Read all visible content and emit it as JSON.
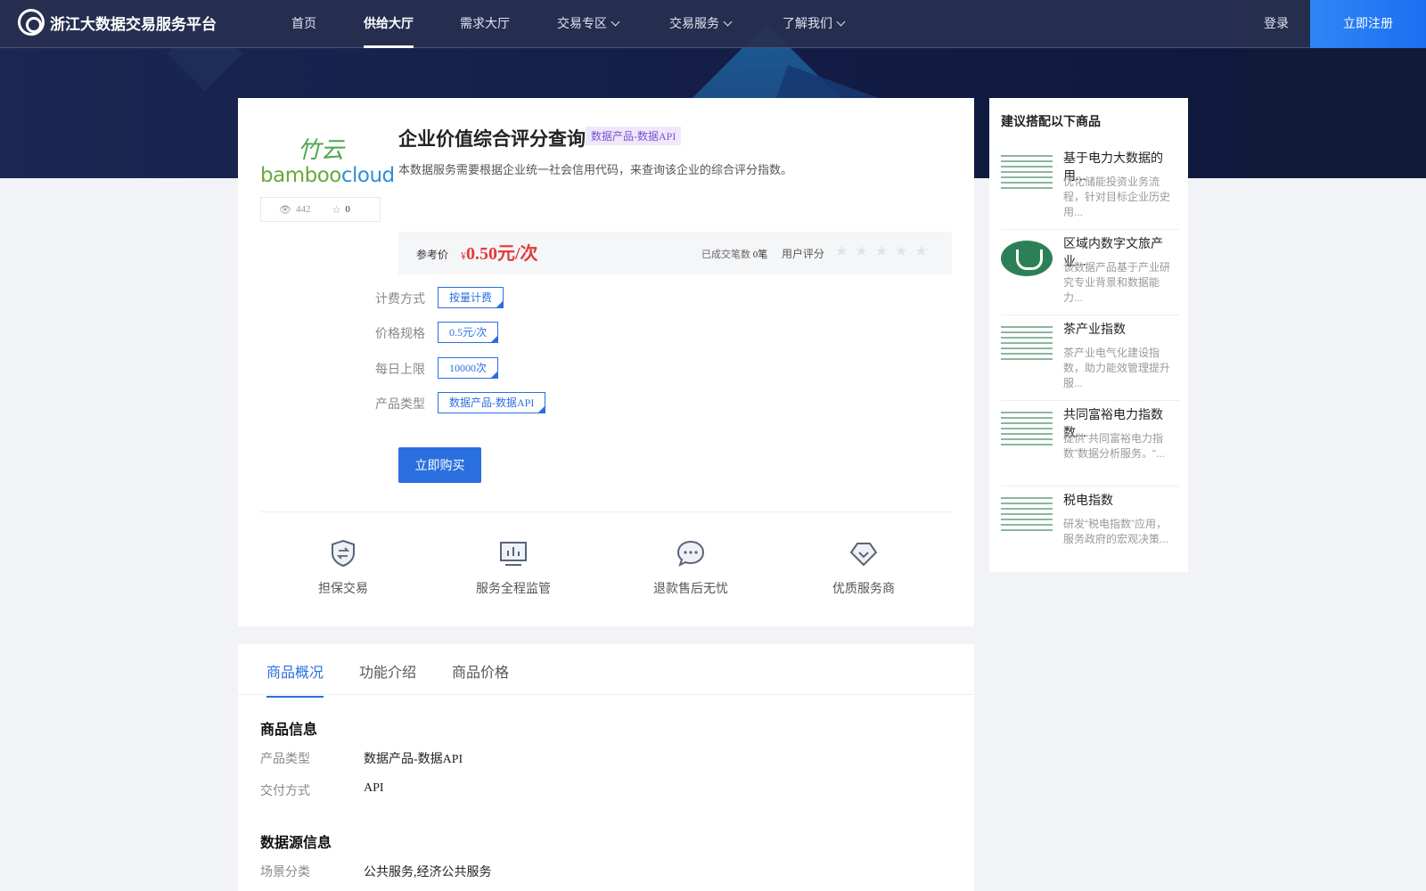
{
  "nav": {
    "brand": "浙江大数据交易服务平台",
    "items": [
      {
        "label": "首页"
      },
      {
        "label": "供给大厅"
      },
      {
        "label": "需求大厅"
      },
      {
        "label": "交易专区"
      },
      {
        "label": "交易服务"
      },
      {
        "label": "了解我们"
      }
    ],
    "login": "登录",
    "register": "立即注册"
  },
  "product": {
    "logo_cn": "竹云",
    "logo_en_a": "bamboo",
    "logo_en_b": "cloud",
    "views": "442",
    "favorites": "0",
    "title": "企业价值综合评分查询",
    "tag": "数据产品-数据API",
    "description": "本数据服务需要根据企业统一社会信用代码，来查询该企业的综合评分指数。",
    "price_label": "参考价",
    "currency": "¥",
    "price": "0.50元/次",
    "deals_label": "已成交笔数",
    "deals_value": "0笔",
    "rating_label": "用户评分",
    "stars": "★★★★★",
    "options": [
      {
        "label": "计费方式",
        "value": "按量计费"
      },
      {
        "label": "价格规格",
        "value": "0.5元/次"
      },
      {
        "label": "每日上限",
        "value": "10000次"
      },
      {
        "label": "产品类型",
        "value": "数据产品-数据API"
      }
    ],
    "buy_label": "立即购买",
    "features": [
      {
        "label": "担保交易",
        "icon": "shield-exchange-icon"
      },
      {
        "label": "服务全程监管",
        "icon": "monitor-chart-icon"
      },
      {
        "label": "退款售后无忧",
        "icon": "chat-bubble-icon"
      },
      {
        "label": "优质服务商",
        "icon": "diamond-icon"
      }
    ]
  },
  "tabs": [
    {
      "label": "商品概况"
    },
    {
      "label": "功能介绍"
    },
    {
      "label": "商品价格"
    }
  ],
  "detail": {
    "section1_title": "商品信息",
    "type_key": "产品类型",
    "type_value": "数据产品-数据API",
    "delivery_key": "交付方式",
    "delivery_value": "API",
    "section2_title": "数据源信息",
    "scene_key": "场景分类",
    "scene_value": "公共服务,经济公共服务"
  },
  "side": {
    "title": "建议搭配以下商品",
    "items": [
      {
        "name": "基于电力大数据的用...",
        "desc": "优化储能投资业务流程，针对目标企业历史用..."
      },
      {
        "name": "区域内数字文旅产业...",
        "desc": "该数据产品基于产业研究专业背景和数据能力..."
      },
      {
        "name": "茶产业指数",
        "desc": "茶产业电气化建设指数，助力能效管理提升服..."
      },
      {
        "name": "共同富裕电力指数数...",
        "desc": "提供“共同富裕电力指数”数据分析服务。“..."
      },
      {
        "name": "税电指数",
        "desc": "研发“税电指数”应用，服务政府的宏观决策..."
      }
    ]
  },
  "colors": {
    "accent": "#2a6fe0",
    "price": "#e23a3a",
    "nav_bg": "#283050"
  }
}
